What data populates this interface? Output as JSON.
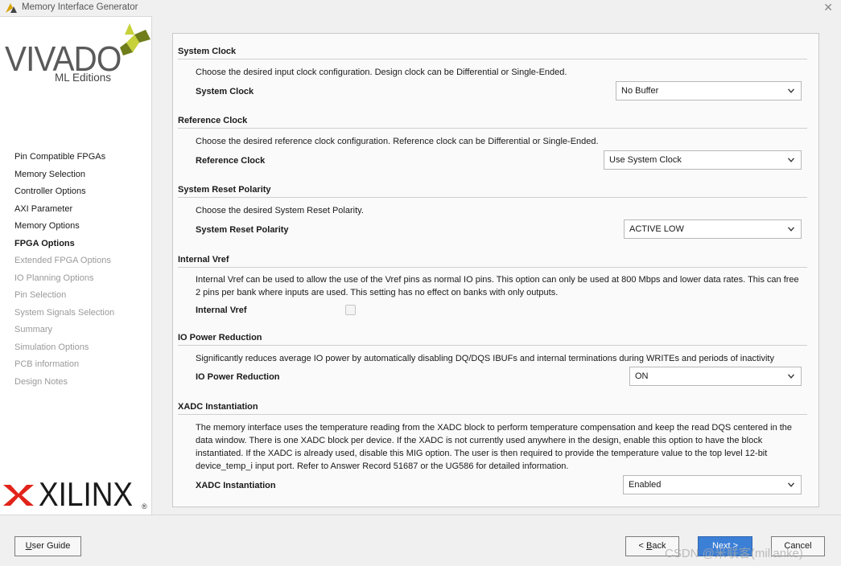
{
  "window": {
    "title": "Memory Interface Generator",
    "close_glyph": "✕"
  },
  "brand": {
    "product": "VIVADO",
    "edition": "ML Editions",
    "vendor": "XILINX",
    "registered": "®"
  },
  "nav": {
    "items": [
      {
        "label": "Pin Compatible FPGAs",
        "state": "normal"
      },
      {
        "label": "Memory Selection",
        "state": "normal"
      },
      {
        "label": "Controller Options",
        "state": "normal"
      },
      {
        "label": "AXI Parameter",
        "state": "normal"
      },
      {
        "label": "Memory Options",
        "state": "normal"
      },
      {
        "label": "FPGA Options",
        "state": "active"
      },
      {
        "label": "Extended FPGA Options",
        "state": "disabled"
      },
      {
        "label": "IO Planning Options",
        "state": "disabled"
      },
      {
        "label": "Pin Selection",
        "state": "disabled"
      },
      {
        "label": "System Signals Selection",
        "state": "disabled"
      },
      {
        "label": "Summary",
        "state": "disabled"
      },
      {
        "label": "Simulation Options",
        "state": "disabled"
      },
      {
        "label": "PCB information",
        "state": "disabled"
      },
      {
        "label": "Design Notes",
        "state": "disabled"
      }
    ]
  },
  "sections": {
    "system_clock": {
      "title": "System Clock",
      "description": "Choose the desired input clock configuration. Design clock can be Differential or Single-Ended.",
      "field_label": "System Clock",
      "value": "No Buffer"
    },
    "reference_clock": {
      "title": "Reference Clock",
      "description": "Choose the desired reference clock configuration. Reference clock can be Differential or Single-Ended.",
      "field_label": "Reference Clock",
      "value": "Use System Clock"
    },
    "reset_polarity": {
      "title": "System Reset Polarity",
      "description": "Choose the desired System Reset Polarity.",
      "field_label": "System Reset Polarity",
      "value": "ACTIVE LOW"
    },
    "internal_vref": {
      "title": "Internal Vref",
      "description_1": "Internal Vref can be used to allow the use of the Vref pins as normal IO pins. This option can only be used at 800 Mbps and lower data rates. This can free",
      "description_2": "2 pins per bank where inputs are used. This setting has no effect on banks with only outputs.",
      "field_label": "Internal Vref",
      "checked": false
    },
    "io_power": {
      "title": "IO Power Reduction",
      "description": "Significantly reduces average IO power by automatically disabling DQ/DQS IBUFs and internal terminations during WRITEs and periods of inactivity",
      "field_label": "IO Power Reduction",
      "value": "ON"
    },
    "xadc": {
      "title": "XADC Instantiation",
      "description_1": "The memory interface uses the temperature reading from the XADC block to perform temperature compensation and keep the read DQS centered in the",
      "description_2": "data window. There is one XADC block per device. If the XADC is not currently used anywhere in the design, enable this option to have the block",
      "description_3": "instantiated. If the XADC is already used, disable this MIG option. The user is then required to provide the temperature value to the top level 12-bit",
      "description_4": "device_temp_i input port. Refer to Answer Record 51687 or the UG586 for detailed information.",
      "field_label": "XADC Instantiation",
      "value": "Enabled"
    }
  },
  "buttons": {
    "user_guide_prefix": "",
    "user_guide_underlined": "U",
    "user_guide_rest": "ser Guide",
    "back_prefix": "< ",
    "back_underlined": "B",
    "back_rest": "ack",
    "next": "Next >",
    "cancel": "Cancel"
  },
  "watermark": "CSDN @米联客(milianke)",
  "colors": {
    "accent": "#3b7fd6",
    "leaf_dark": "#6f7d1a",
    "leaf_light": "#c7d13a",
    "xilinx_red": "#e2231a"
  }
}
